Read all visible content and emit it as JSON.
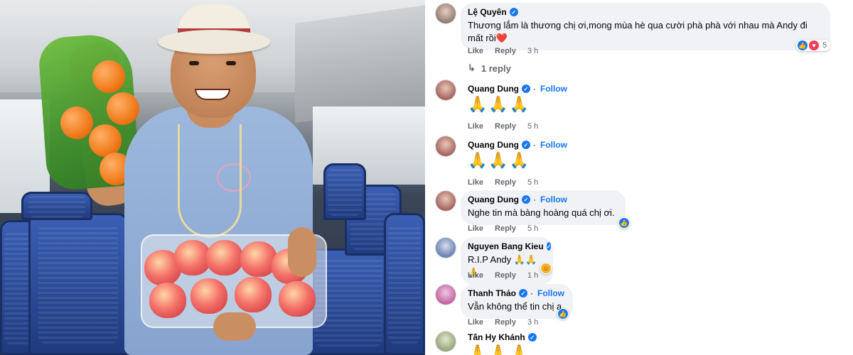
{
  "comments": [
    {
      "name": "Lệ Quyên",
      "verified": true,
      "follow": "",
      "text": "Thương lắm là thương chị ơi,mong mùa hè qua cười phà phà với nhau mà Andy đi mất rồi",
      "text_emoji": "❤️",
      "like": "Like",
      "reply": "Reply",
      "time": "3 h",
      "reaction_count": "5",
      "replies_label": "1 reply",
      "avatar_color": "#6b5a52"
    },
    {
      "name": "Quang Dung",
      "verified": true,
      "follow": "Follow",
      "emoji": "🙏🙏🙏",
      "like": "Like",
      "reply": "Reply",
      "time": "5 h",
      "avatar_color": "#8a3a3a"
    },
    {
      "name": "Quang Dung",
      "verified": true,
      "follow": "Follow",
      "emoji": "🙏🙏🙏",
      "like": "Like",
      "reply": "Reply",
      "time": "5 h",
      "avatar_color": "#8a3a3a"
    },
    {
      "name": "Quang Dung",
      "verified": true,
      "follow": "Follow",
      "text": "Nghe tin mà bàng hoàng quá chị ơi.",
      "like": "Like",
      "reply": "Reply",
      "time": "5 h",
      "avatar_color": "#8a3a3a"
    },
    {
      "name": "Nguyen Bang Kieu",
      "verified": true,
      "follow": "",
      "text": "R.I.P Andy 🙏🙏🙏",
      "like": "Like",
      "reply": "Reply",
      "time": "1 h",
      "avatar_color": "#3a5aa0"
    },
    {
      "name": "Thanh Thảo",
      "verified": true,
      "follow": "Follow",
      "text": "Vẫn không thể tin chị a",
      "like": "Like",
      "reply": "Reply",
      "time": "3 h",
      "avatar_color": "#b03a8a"
    },
    {
      "name": "Tân Hy Khánh",
      "verified": true,
      "follow": "",
      "emoji": "🙏🙏🙏",
      "avatar_color": "#7a8a5a"
    }
  ]
}
